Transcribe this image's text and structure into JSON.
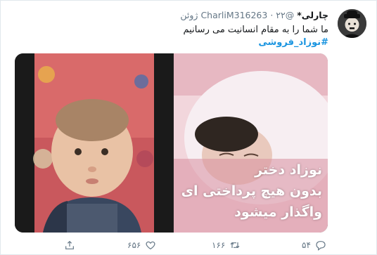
{
  "tweet": {
    "display_name": "چارلی*",
    "handle": "@CharliM316263",
    "separator": "·",
    "timestamp": "۲۲ ژوئن",
    "text": "ما شما را به مقام انسانیت می رسانیم",
    "hashtag": "#نوزاد_فروشی"
  },
  "media": {
    "overlay_lines": [
      "نوزاد دختر",
      "بدون هیچ پرداختی ای",
      "واگذار میشود"
    ]
  },
  "actions": {
    "reply": {
      "icon": "reply-icon",
      "count": "۵۴"
    },
    "retweet": {
      "icon": "retweet-icon",
      "count": "۱۶۶"
    },
    "like": {
      "icon": "heart-icon",
      "count": "۶۵۶"
    },
    "share": {
      "icon": "share-icon"
    }
  },
  "colors": {
    "link": "#1b95e0",
    "muted": "#657786",
    "text": "#14171a"
  }
}
